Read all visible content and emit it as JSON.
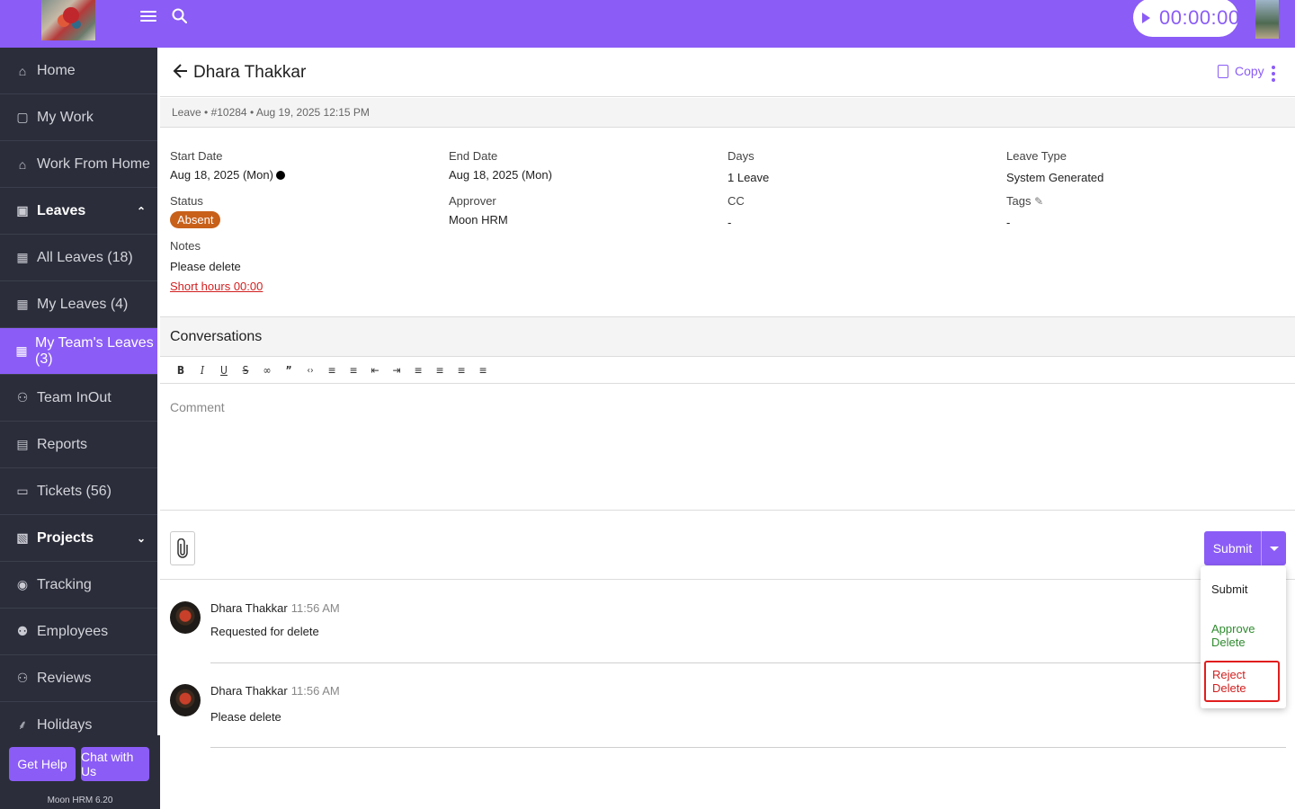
{
  "topbar": {
    "timer": "00:00:00",
    "accent": "#8b5cf6"
  },
  "sidebar": {
    "items": [
      {
        "label": "Home",
        "icon": "home-icon"
      },
      {
        "label": "My Work",
        "icon": "briefcase-icon"
      },
      {
        "label": "Work From Home",
        "icon": "house-icon"
      },
      {
        "label": "Leaves",
        "icon": "calendar-icon",
        "section": true,
        "expanded": true
      },
      {
        "label": "All Leaves (18)",
        "icon": "calendar-icon"
      },
      {
        "label": "My Leaves (4)",
        "icon": "calendar-icon"
      },
      {
        "label": "My Team's Leaves (3)",
        "icon": "calendar-icon",
        "active": true
      },
      {
        "label": "Team InOut",
        "icon": "team-icon"
      },
      {
        "label": "Reports",
        "icon": "report-icon"
      },
      {
        "label": "Tickets (56)",
        "icon": "ticket-icon"
      },
      {
        "label": "Projects",
        "icon": "projects-icon",
        "section": true,
        "expanded": false
      },
      {
        "label": "Tracking",
        "icon": "tracking-icon"
      },
      {
        "label": "Employees",
        "icon": "employees-icon"
      },
      {
        "label": "Reviews",
        "icon": "reviews-icon"
      },
      {
        "label": "Holidays",
        "icon": "palm-icon"
      }
    ],
    "get_help": "Get Help",
    "chat": "Chat with Us",
    "version": "Moon HRM 6.20"
  },
  "header": {
    "title": "Dhara Thakkar",
    "copy": "Copy",
    "meta": "Leave • #10284 • Aug 19, 2025 12:15 PM"
  },
  "details": {
    "start_date_label": "Start Date",
    "start_date": "Aug 18, 2025 (Mon)",
    "end_date_label": "End Date",
    "end_date": "Aug 18, 2025 (Mon)",
    "days_label": "Days",
    "days": "1 Leave",
    "leave_type_label": "Leave Type",
    "leave_type": "System Generated",
    "status_label": "Status",
    "status": "Absent",
    "approver_label": "Approver",
    "approver": "Moon HRM",
    "cc_label": "CC",
    "cc": "-",
    "tags_label": "Tags",
    "tags": "-",
    "notes_label": "Notes",
    "notes": "Please delete",
    "short_hours": "Short hours 00:00"
  },
  "conversations": {
    "title": "Conversations",
    "comment_placeholder": "Comment",
    "submit": "Submit",
    "comments": [
      {
        "name": "Dhara Thakkar",
        "time": "11:56 AM",
        "message": "Requested for delete"
      },
      {
        "name": "Dhara Thakkar",
        "time": "11:56 AM",
        "message": "Please delete"
      }
    ]
  },
  "dropdown": {
    "submit": "Submit",
    "approve": "Approve Delete",
    "reject": "Reject Delete"
  }
}
